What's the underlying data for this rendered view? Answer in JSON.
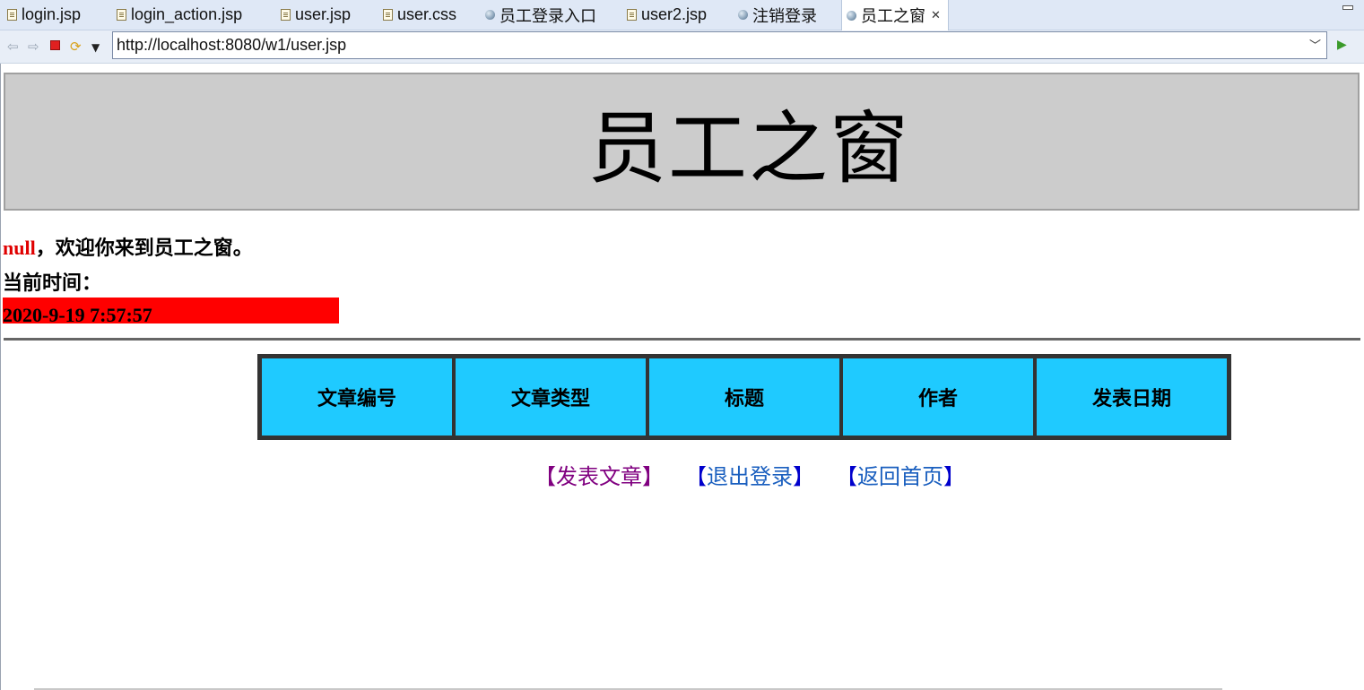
{
  "tabs": [
    {
      "label": "login.jsp",
      "icon": "file-icon",
      "active": false
    },
    {
      "label": "login_action.jsp",
      "icon": "file-icon",
      "active": false
    },
    {
      "label": "user.jsp",
      "icon": "file-icon",
      "active": false
    },
    {
      "label": "user.css",
      "icon": "file-icon",
      "active": false
    },
    {
      "label": "员工登录入口",
      "icon": "globe-icon",
      "active": false
    },
    {
      "label": "user2.jsp",
      "icon": "file-icon",
      "active": false
    },
    {
      "label": "注销登录",
      "icon": "globe-icon",
      "active": false
    },
    {
      "label": "员工之窗",
      "icon": "globe-icon",
      "active": true,
      "close": "✕"
    }
  ],
  "browser": {
    "url": "http://localhost:8080/w1/user.jsp",
    "buttons": [
      "back-icon",
      "forward-icon",
      "stop-icon",
      "refresh-icon",
      "menu-dropdown-icon",
      "go-icon"
    ]
  },
  "page": {
    "title": "员工之窗",
    "welcome_name": "null",
    "welcome_text": "，欢迎你来到员工之窗。",
    "time_label": "当前时间：",
    "time_value": "2020-9-19 7:57:57",
    "table_headers": [
      "文章编号",
      "文章类型",
      "标题",
      "作者",
      "发表日期"
    ],
    "links": [
      {
        "text": "发表文章",
        "state": "visited"
      },
      {
        "text": "退出登录",
        "state": "normal"
      },
      {
        "text": "返回首页",
        "state": "normal"
      }
    ],
    "bracket_open": "【",
    "bracket_close": "】"
  },
  "colors": {
    "header_bg": "#cccccc",
    "time_bar": "#ff0000",
    "table_header_bg": "#1fcaff",
    "username": "#e00000",
    "link_visited": "#800080",
    "link_normal": "#1a5fbf"
  }
}
